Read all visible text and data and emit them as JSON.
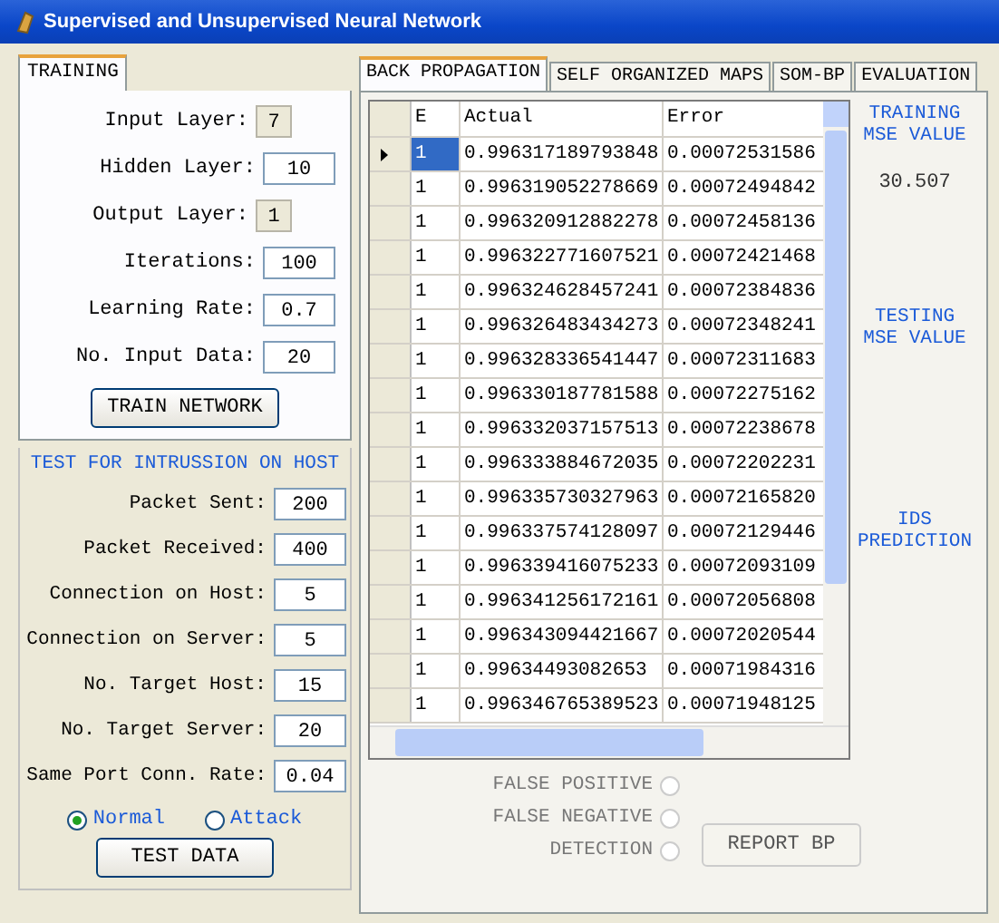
{
  "window": {
    "title": "Supervised and Unsupervised Neural Network"
  },
  "training": {
    "tab": {
      "label": "TRAINING",
      "selected": true
    },
    "fields": [
      {
        "label": "Input Layer:",
        "value": "7",
        "disabled": true
      },
      {
        "label": "Hidden Layer:",
        "value": "10",
        "disabled": false
      },
      {
        "label": "Output Layer:",
        "value": "1",
        "disabled": true
      },
      {
        "label": "Iterations:",
        "value": "100",
        "disabled": false
      },
      {
        "label": "Learning Rate:",
        "value": "0.7",
        "disabled": false
      },
      {
        "label": "No. Input Data:",
        "value": "20",
        "disabled": false
      }
    ],
    "button": "TRAIN NETWORK"
  },
  "test": {
    "title": "TEST FOR INTRUSSION ON HOST",
    "fields": [
      {
        "label": "Packet Sent:",
        "value": "200"
      },
      {
        "label": "Packet Received:",
        "value": "400"
      },
      {
        "label": "Connection on Host:",
        "value": "5"
      },
      {
        "label": "Connection on Server:",
        "value": "5"
      },
      {
        "label": "No. Target Host:",
        "value": "15"
      },
      {
        "label": "No. Target Server:",
        "value": "20"
      },
      {
        "label": "Same Port Conn. Rate:",
        "value": "0.04"
      }
    ],
    "options": [
      {
        "label": "Normal",
        "selected": true
      },
      {
        "label": "Attack",
        "selected": false
      }
    ],
    "button": "TEST DATA"
  },
  "tabs": [
    {
      "label": "BACK PROPAGATION",
      "selected": true
    },
    {
      "label": "SELF ORGANIZED MAPS",
      "selected": false
    },
    {
      "label": "SOM-BP",
      "selected": false
    },
    {
      "label": "EVALUATION",
      "selected": false
    }
  ],
  "table": {
    "columns": [
      "E",
      "Actual",
      "Error"
    ],
    "rows": [
      {
        "cells": [
          "1",
          "0.996317189793848",
          "0.00072531586"
        ],
        "selected": true
      },
      {
        "cells": [
          "1",
          "0.996319052278669",
          "0.00072494842"
        ],
        "selected": false
      },
      {
        "cells": [
          "1",
          "0.996320912882278",
          "0.00072458136"
        ],
        "selected": false
      },
      {
        "cells": [
          "1",
          "0.996322771607521",
          "0.00072421468"
        ],
        "selected": false
      },
      {
        "cells": [
          "1",
          "0.996324628457241",
          "0.00072384836"
        ],
        "selected": false
      },
      {
        "cells": [
          "1",
          "0.996326483434273",
          "0.00072348241"
        ],
        "selected": false
      },
      {
        "cells": [
          "1",
          "0.996328336541447",
          "0.00072311683"
        ],
        "selected": false
      },
      {
        "cells": [
          "1",
          "0.996330187781588",
          "0.00072275162"
        ],
        "selected": false
      },
      {
        "cells": [
          "1",
          "0.996332037157513",
          "0.00072238678"
        ],
        "selected": false
      },
      {
        "cells": [
          "1",
          "0.996333884672035",
          "0.00072202231"
        ],
        "selected": false
      },
      {
        "cells": [
          "1",
          "0.996335730327963",
          "0.00072165820"
        ],
        "selected": false
      },
      {
        "cells": [
          "1",
          "0.996337574128097",
          "0.00072129446"
        ],
        "selected": false
      },
      {
        "cells": [
          "1",
          "0.996339416075233",
          "0.00072093109"
        ],
        "selected": false
      },
      {
        "cells": [
          "1",
          "0.996341256172161",
          "0.00072056808"
        ],
        "selected": false
      },
      {
        "cells": [
          "1",
          "0.996343094421667",
          "0.00072020544"
        ],
        "selected": false
      },
      {
        "cells": [
          "1",
          "0.99634493082653",
          "0.00071984316"
        ],
        "selected": false
      },
      {
        "cells": [
          "1",
          "0.996346765389523",
          "0.00071948125"
        ],
        "selected": false
      }
    ]
  },
  "results": [
    {
      "label": "TRAINING MSE VALUE",
      "value": "30.507"
    },
    {
      "label": "TESTING MSE VALUE"
    },
    {
      "label": "IDS PREDICTION"
    }
  ],
  "evaluation": [
    {
      "label": "FALSE POSITIVE",
      "selected": false
    },
    {
      "label": "FALSE NEGATIVE",
      "selected": false
    },
    {
      "label": "DETECTION",
      "selected": false
    }
  ],
  "report_button": "REPORT BP"
}
